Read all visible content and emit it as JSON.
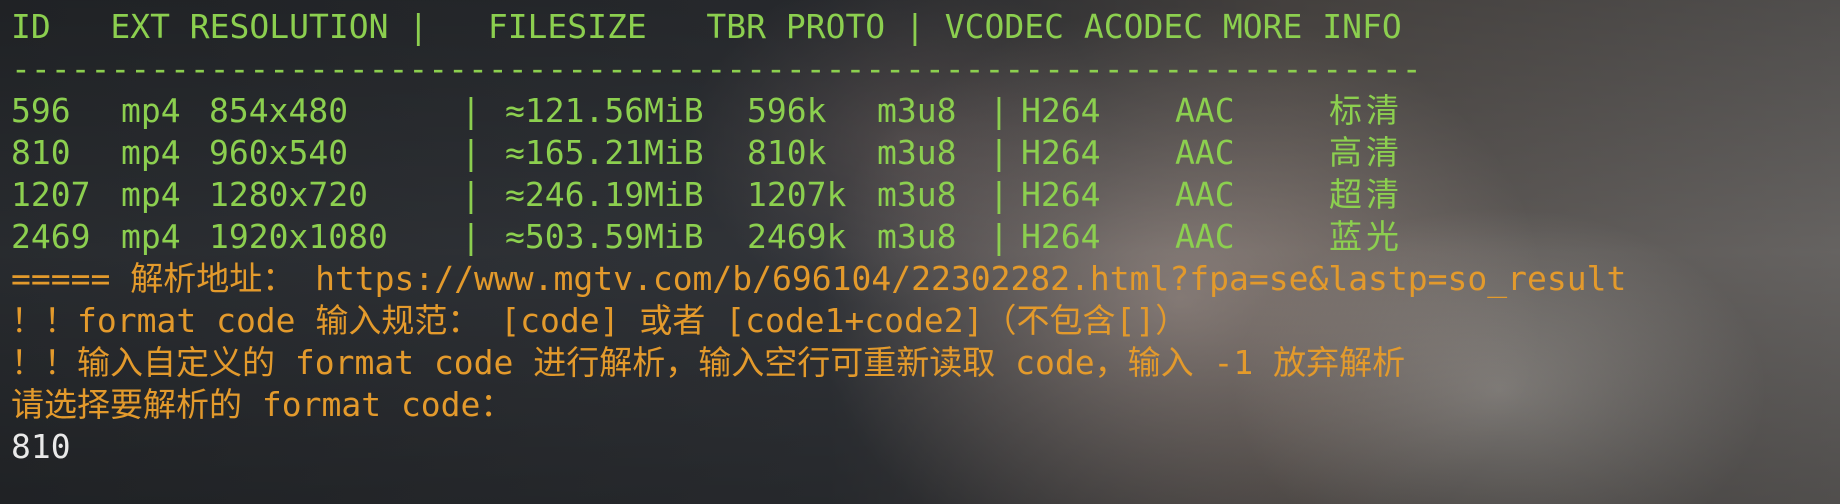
{
  "header_row": "ID   EXT RESOLUTION |   FILESIZE   TBR PROTO | VCODEC ACODEC MORE INFO",
  "separator": "-----------------------------------------------------------------------",
  "formats": [
    {
      "id": "596",
      "ext": "mp4",
      "resolution": "854x480",
      "filesize": "≈121.56MiB",
      "tbr": "596k",
      "proto": "m3u8",
      "vcodec": "H264",
      "acodec": "AAC",
      "info": "标清"
    },
    {
      "id": "810",
      "ext": "mp4",
      "resolution": "960x540",
      "filesize": "≈165.21MiB",
      "tbr": "810k",
      "proto": "m3u8",
      "vcodec": "H264",
      "acodec": "AAC",
      "info": "高清"
    },
    {
      "id": "1207",
      "ext": "mp4",
      "resolution": "1280x720",
      "filesize": "≈246.19MiB",
      "tbr": "1207k",
      "proto": "m3u8",
      "vcodec": "H264",
      "acodec": "AAC",
      "info": "超清"
    },
    {
      "id": "2469",
      "ext": "mp4",
      "resolution": "1920x1080",
      "filesize": "≈503.59MiB",
      "tbr": "2469k",
      "proto": "m3u8",
      "vcodec": "H264",
      "acodec": "AAC",
      "info": "蓝光"
    }
  ],
  "pipe": "|",
  "parse_url_line": "===== 解析地址： https://www.mgtv.com/b/696104/22302282.html?fpa=se&lastp=so_result",
  "hint_line_1": "！！format code 输入规范： [code] 或者 [code1+code2]（不包含[]）",
  "hint_line_2": "！！输入自定义的 format code 进行解析，输入空行可重新读取 code，输入 -1 放弃解析",
  "prompt_line": "请选择要解析的 format code：",
  "user_input": "810",
  "colors": {
    "green": "#8ccf4f",
    "orange": "#e39a2c",
    "white": "#e9e9e9"
  }
}
